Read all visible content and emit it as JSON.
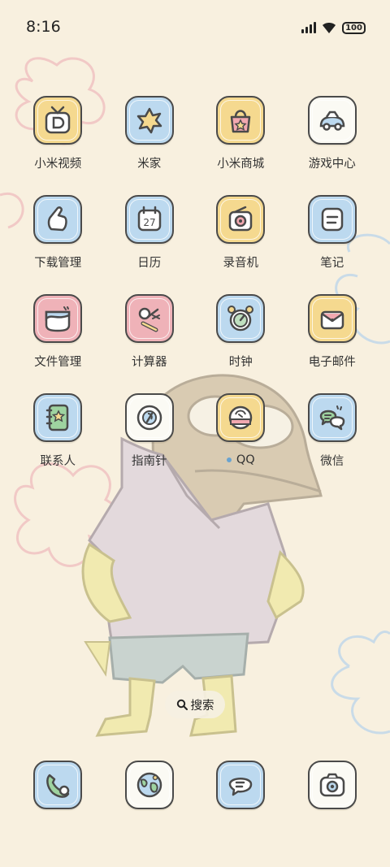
{
  "status_bar": {
    "time": "8:16",
    "battery": "100"
  },
  "colors": {
    "background": "#f8f0df",
    "yellow": "#f5d98f",
    "blue": "#bcd9ef",
    "pink": "#efb2b8",
    "white": "#fbfaf4"
  },
  "apps": [
    {
      "label": "小米视频",
      "icon": "tv-icon",
      "color": "yellow"
    },
    {
      "label": "米家",
      "icon": "sun-icon",
      "color": "blue"
    },
    {
      "label": "小米商城",
      "icon": "shopping-bag-icon",
      "color": "yellow"
    },
    {
      "label": "游戏中心",
      "icon": "game-controller-icon",
      "color": "white"
    },
    {
      "label": "下载管理",
      "icon": "hand-icon",
      "color": "blue"
    },
    {
      "label": "日历",
      "icon": "calendar-icon",
      "color": "blue",
      "day": "27"
    },
    {
      "label": "录音机",
      "icon": "recorder-icon",
      "color": "yellow"
    },
    {
      "label": "笔记",
      "icon": "notes-icon",
      "color": "blue"
    },
    {
      "label": "文件管理",
      "icon": "folder-icon",
      "color": "pink"
    },
    {
      "label": "计算器",
      "icon": "calculator-icon",
      "color": "pink"
    },
    {
      "label": "时钟",
      "icon": "alarm-clock-icon",
      "color": "blue"
    },
    {
      "label": "电子邮件",
      "icon": "envelope-icon",
      "color": "yellow"
    },
    {
      "label": "联系人",
      "icon": "contacts-book-icon",
      "color": "blue"
    },
    {
      "label": "指南针",
      "icon": "compass-icon",
      "color": "white"
    },
    {
      "label": "QQ",
      "icon": "qq-icon",
      "color": "yellow",
      "badge": true
    },
    {
      "label": "微信",
      "icon": "wechat-icon",
      "color": "blue"
    }
  ],
  "search": {
    "label": "搜索",
    "icon": "search-icon"
  },
  "dock": [
    {
      "icon": "phone-icon",
      "color": "blue"
    },
    {
      "icon": "browser-globe-icon",
      "color": "white"
    },
    {
      "icon": "messages-icon",
      "color": "blue"
    },
    {
      "icon": "camera-icon",
      "color": "white"
    }
  ]
}
